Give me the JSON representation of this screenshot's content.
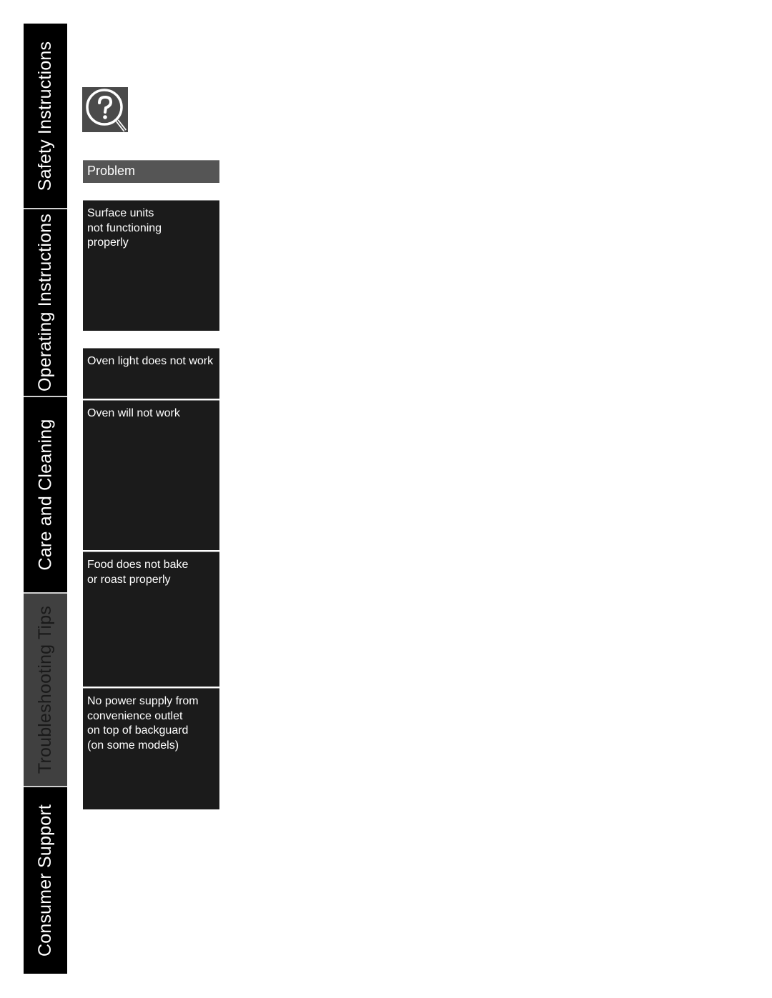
{
  "sidebar": {
    "tabs": [
      {
        "label": "Safety Instructions",
        "active": false
      },
      {
        "label": "Operating Instructions",
        "active": false
      },
      {
        "label": "Care and Cleaning",
        "active": false
      },
      {
        "label": "Troubleshooting Tips",
        "active": true
      },
      {
        "label": "Consumer Support",
        "active": false
      }
    ]
  },
  "icon": {
    "name": "question-magnifier-icon"
  },
  "table": {
    "header": "Problem",
    "rows": [
      {
        "problem": "Surface units\nnot functioning\nproperly"
      },
      {
        "problem": "Oven light does not work"
      },
      {
        "problem": "Oven will not work"
      },
      {
        "problem": "Food does not bake\nor roast properly"
      },
      {
        "problem": "No power supply from\nconvenience outlet\non top of backguard\n(on some models)"
      }
    ]
  },
  "colors": {
    "tab_bg": "#000000",
    "tab_active_bg": "#404040",
    "row_bg": "#1b1b1b",
    "header_bg": "#555555"
  }
}
